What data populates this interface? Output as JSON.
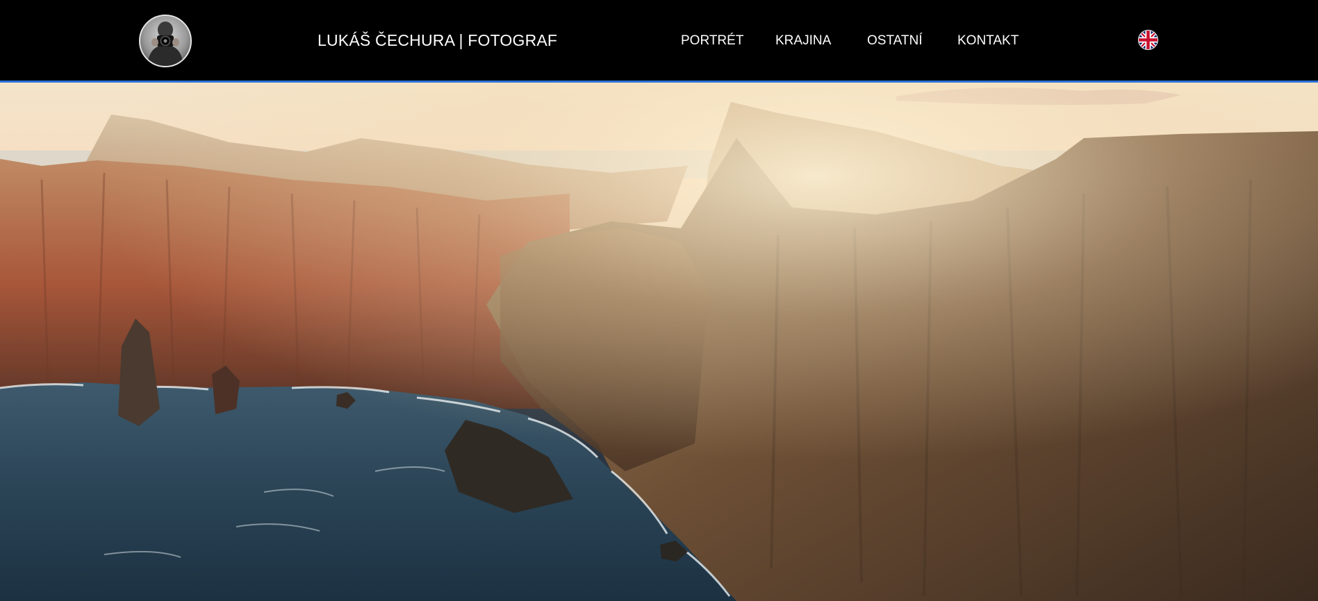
{
  "header": {
    "avatar_icon": "photographer-avatar-icon",
    "site_title": "LUKÁŠ ČECHURA | FOTOGRAF",
    "nav": [
      {
        "label": "PORTRÉT"
      },
      {
        "label": "KRAJINA"
      },
      {
        "label": "OSTATNÍ"
      },
      {
        "label": "KONTAKT"
      }
    ],
    "language_icon": "uk-flag-icon"
  },
  "hero": {
    "image_icon": "sea-cliffs-landscape-photo"
  },
  "colors": {
    "header_bg": "#000000",
    "header_accent": "#2a72d8",
    "text": "#ffffff"
  }
}
